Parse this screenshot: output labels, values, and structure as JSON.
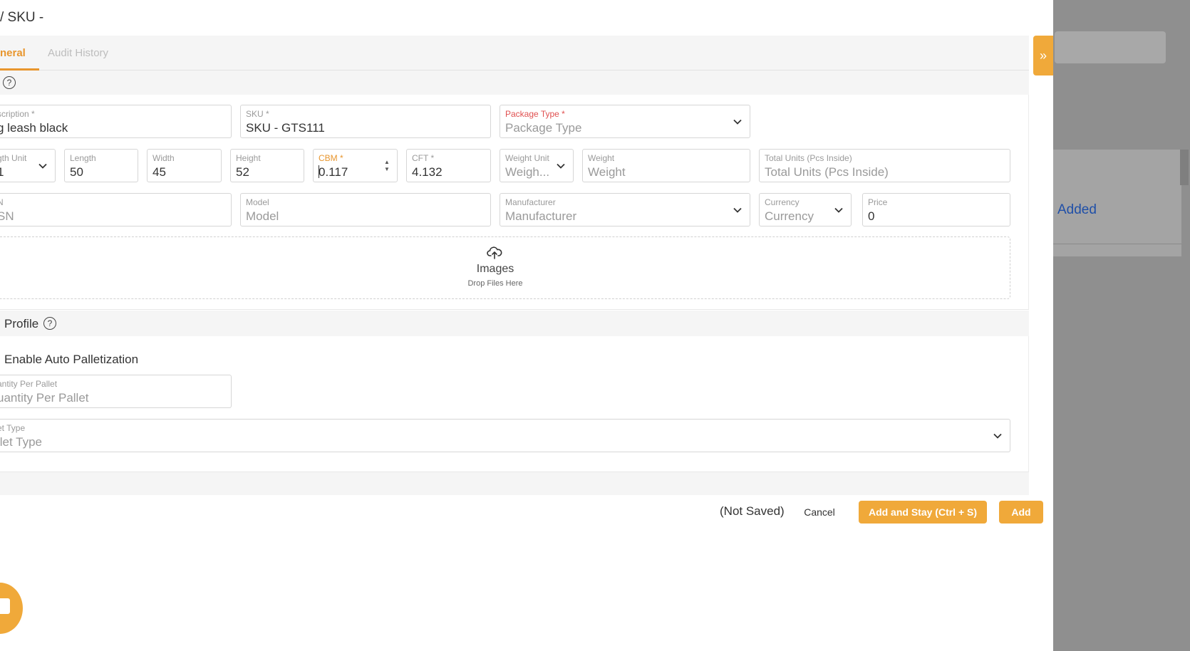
{
  "modal": {
    "title": "/ SKU -",
    "tabs": [
      {
        "label": "neral",
        "active": true
      },
      {
        "label": "Audit History",
        "active": false
      }
    ],
    "collapse_label": "»"
  },
  "general": {
    "description": {
      "label": "scription *",
      "value": "g leash black"
    },
    "sku": {
      "label": "SKU *",
      "value": "SKU - GTS111"
    },
    "package_type": {
      "label": "Package Type *",
      "placeholder": "Package Type"
    },
    "length_unit": {
      "label": "gth Unit",
      "value": "1"
    },
    "length": {
      "label": "Length",
      "value": "50"
    },
    "width": {
      "label": "Width",
      "value": "45"
    },
    "height": {
      "label": "Height",
      "value": "52"
    },
    "cbm": {
      "label": "CBM *",
      "value": "0.117"
    },
    "cft": {
      "label": "CFT *",
      "value": "4.132"
    },
    "weight_unit": {
      "label": "Weight Unit",
      "placeholder": "Weigh..."
    },
    "weight": {
      "label": "Weight",
      "placeholder": "Weight"
    },
    "total_units": {
      "label": "Total Units (Pcs Inside)",
      "placeholder": "Total Units (Pcs Inside)"
    },
    "upc": {
      "label": "N",
      "placeholder": "SN"
    },
    "model": {
      "label": "Model",
      "placeholder": "Model"
    },
    "manufacturer": {
      "label": "Manufacturer",
      "placeholder": "Manufacturer"
    },
    "currency": {
      "label": "Currency",
      "placeholder": "Currency"
    },
    "price": {
      "label": "Price",
      "value": "0"
    },
    "images": {
      "title": "Images",
      "subtitle": "Drop Files Here"
    }
  },
  "pallet": {
    "section_title": "Profile",
    "enable_label": "Enable Auto Palletization",
    "qty_per_pallet": {
      "label": "antity Per Pallet",
      "placeholder": "uantity Per Pallet"
    },
    "pallet_type": {
      "label": "et Type",
      "placeholder": "llet Type"
    }
  },
  "footer": {
    "status": "(Not Saved)",
    "cancel": "Cancel",
    "add_and_stay": "Add and Stay (Ctrl + S)",
    "add": "Add"
  },
  "background": {
    "added_text": "Added"
  },
  "colors": {
    "accent": "#f0a93a",
    "tab_active": "#e8962e",
    "required_red": "#e05050",
    "link_blue": "#1f4fa8"
  },
  "icons": {
    "help": "question-circle-icon",
    "upload": "cloud-upload-icon",
    "chevron": "chevron-down-icon",
    "collapse": "double-chevron-right-icon",
    "chat": "chat-icon"
  }
}
